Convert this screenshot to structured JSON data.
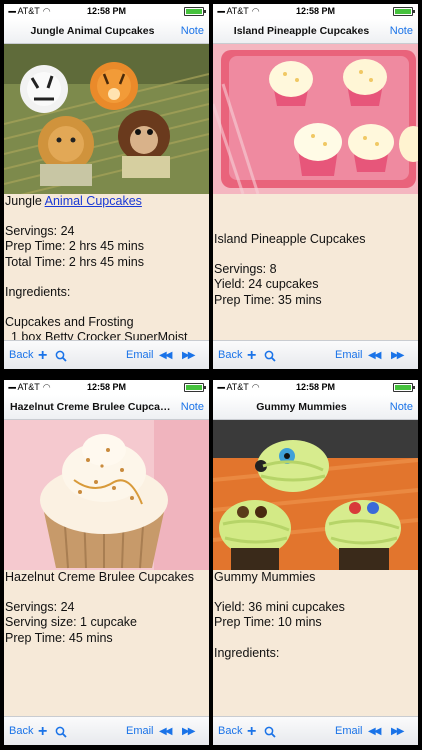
{
  "status": {
    "carrier": "AT&T",
    "time": "12:58 PM"
  },
  "toolbar": {
    "back": "Back",
    "email": "Email"
  },
  "nav_note": "Note",
  "screens": [
    {
      "title": "Jungle Animal Cupcakes",
      "heading_prefix": "Jungle ",
      "heading_link": "Animal Cupcakes",
      "lines1": [
        "Servings: 24",
        "Prep Time: 2 hrs 45 mins",
        "Total Time: 2 hrs 45 mins"
      ],
      "lines2": [
        "Ingredients:"
      ],
      "lines3": [
        "Cupcakes and Frosting",
        "1 box Betty Crocker SuperMoist"
      ]
    },
    {
      "title": "Island Pineapple Cupcakes",
      "heading": "Island Pineapple Cupcakes",
      "lines1": [
        "Servings: 8",
        "Yield: 24 cupcakes",
        "Prep Time: 35 mins"
      ]
    },
    {
      "title": "Hazelnut Creme Brulee Cupcakes",
      "heading": "Hazelnut Creme Brulee Cupcakes",
      "lines1": [
        "Servings: 24",
        "Serving size: 1 cupcake",
        "Prep Time: 45 mins"
      ]
    },
    {
      "title": "Gummy Mummies",
      "heading": "Gummy Mummies",
      "lines1": [
        "Yield: 36 mini cupcakes",
        "Prep Time: 10 mins"
      ],
      "lines2": [
        "Ingredients:"
      ]
    }
  ]
}
